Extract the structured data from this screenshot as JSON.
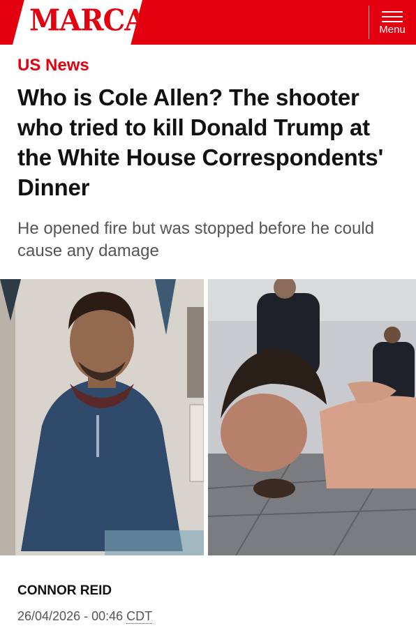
{
  "header": {
    "logo_text": "MARCA",
    "menu_label": "Menu",
    "brand_color": "#e3000f"
  },
  "article": {
    "section": "US News",
    "headline": "Who is Cole Allen? The shooter who tried to kill Donald Trump at the White House Correspondents' Dinner",
    "subheadline": "He opened fire but was stopped before he could cause any damage",
    "author": "CONNOR REID",
    "date": "26/04/2026 - 00:46",
    "timezone": "CDT"
  },
  "images": {
    "left_icon": "portrait-photo",
    "right_icon": "arrest-photo"
  }
}
